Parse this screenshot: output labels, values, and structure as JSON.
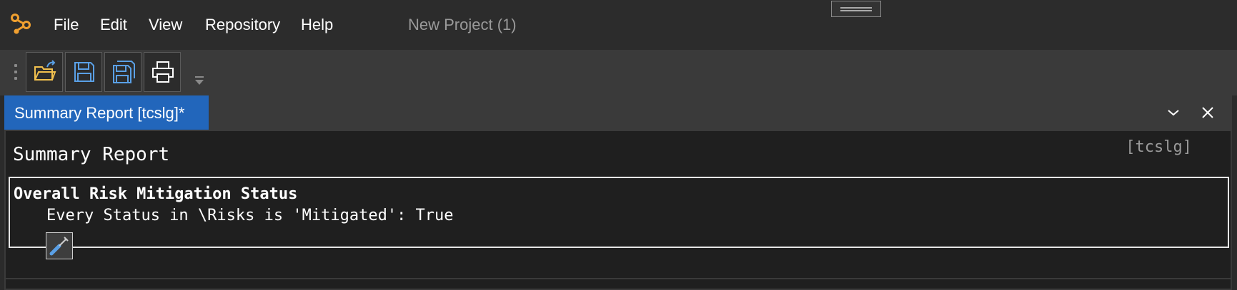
{
  "menu": {
    "items": [
      "File",
      "Edit",
      "View",
      "Repository",
      "Help"
    ],
    "project_title": "New Project (1)"
  },
  "toolbar": {
    "buttons": [
      "open-folder-icon",
      "save-icon",
      "save-all-icon",
      "print-icon"
    ]
  },
  "tab": {
    "label": "Summary Report [tcslg]*"
  },
  "report": {
    "title": "Summary Report",
    "tag": "[tcslg]",
    "section_heading": "Overall Risk Mitigation Status",
    "section_detail": "Every Status in \\Risks is 'Mitigated': True"
  },
  "colors": {
    "accent_tab": "#2266bb",
    "logo": "#f0a030",
    "icon_blue": "#5aa0e6",
    "folder_yellow": "#f2c14e"
  }
}
